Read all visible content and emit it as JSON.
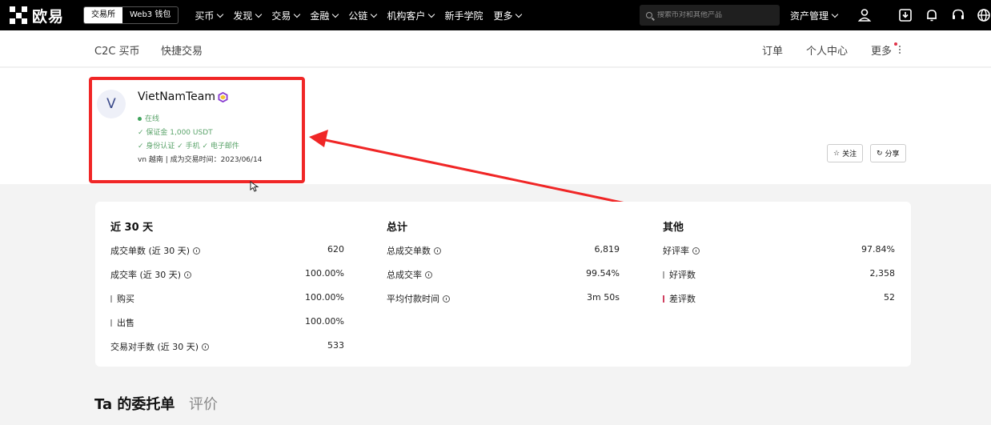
{
  "topnav": {
    "logo": "欧易",
    "mode_exchange": "交易所",
    "mode_web3": "Web3 钱包",
    "menu": [
      "买币",
      "发现",
      "交易",
      "金融",
      "公链",
      "机构客户",
      "新手学院",
      "更多"
    ],
    "search_placeholder": "搜索币对和其他产品",
    "asset_menu": "资产管理",
    "icons": [
      "user-icon",
      "download-icon",
      "bell-icon",
      "headset-icon",
      "globe-icon"
    ]
  },
  "subnav": {
    "left": [
      "C2C 买币",
      "快捷交易"
    ],
    "right": [
      "订单",
      "个人中心",
      "更多"
    ]
  },
  "profile": {
    "avatar_letter": "V",
    "name": "VietNamTeam",
    "status": "在线",
    "deposit": "✓ 保证金 1,000 USDT",
    "verifications": "✓ 身份认证  ✓ 手机  ✓ 电子邮件",
    "region_line": "vn 越南 | 成为交易时间：2023/06/14",
    "follow_button": "关注",
    "share_button": "分享"
  },
  "stats": {
    "recent": {
      "title": "近 30 天",
      "rows": [
        {
          "label": "成交单数 (近 30 天)",
          "value": "620",
          "info": true
        },
        {
          "label": "成交率 (近 30 天)",
          "value": "100.00%",
          "info": true
        },
        {
          "label": "购买",
          "value": "100.00%",
          "bar": true
        },
        {
          "label": "出售",
          "value": "100.00%",
          "bar": true
        },
        {
          "label": "交易对手数 (近 30 天)",
          "value": "533",
          "info": true
        }
      ]
    },
    "total": {
      "title": "总计",
      "rows": [
        {
          "label": "总成交单数",
          "value": "6,819",
          "info": true
        },
        {
          "label": "总成交率",
          "value": "99.54%",
          "info": true
        },
        {
          "label": "平均付款时间",
          "value": "3m 50s",
          "info": true
        }
      ]
    },
    "other": {
      "title": "其他",
      "rows": [
        {
          "label": "好评率",
          "value": "97.84%",
          "info": true
        },
        {
          "label": "好评数",
          "value": "2,358",
          "bar": true
        },
        {
          "label": "差评数",
          "value": "52",
          "bar": true,
          "red": true
        }
      ]
    }
  },
  "tabs": [
    "Ta 的委托单",
    "评价"
  ],
  "colors": {
    "highlight_box": "#f02626",
    "online_green": "#3fa45c",
    "accent_red": "#e0334a"
  }
}
